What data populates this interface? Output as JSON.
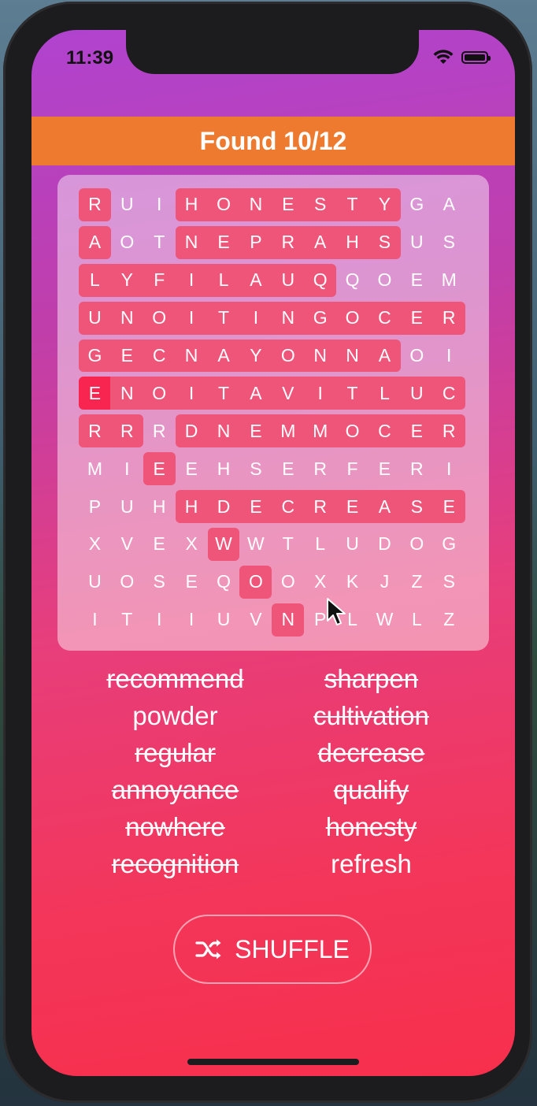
{
  "status_bar": {
    "time": "11:39"
  },
  "header": {
    "found_label": "Found 10/12"
  },
  "grid": {
    "rows": [
      [
        "R",
        "U",
        "I",
        "H",
        "O",
        "N",
        "E",
        "S",
        "T",
        "Y",
        "G",
        "A"
      ],
      [
        "A",
        "O",
        "T",
        "N",
        "E",
        "P",
        "R",
        "A",
        "H",
        "S",
        "U",
        "S"
      ],
      [
        "L",
        "Y",
        "F",
        "I",
        "L",
        "A",
        "U",
        "Q",
        "Q",
        "O",
        "E",
        "M"
      ],
      [
        "U",
        "N",
        "O",
        "I",
        "T",
        "I",
        "N",
        "G",
        "O",
        "C",
        "E",
        "R"
      ],
      [
        "G",
        "E",
        "C",
        "N",
        "A",
        "Y",
        "O",
        "N",
        "N",
        "A",
        "O",
        "I"
      ],
      [
        "E",
        "N",
        "O",
        "I",
        "T",
        "A",
        "V",
        "I",
        "T",
        "L",
        "U",
        "C"
      ],
      [
        "R",
        "R",
        "R",
        "D",
        "N",
        "E",
        "M",
        "M",
        "O",
        "C",
        "E",
        "R"
      ],
      [
        "M",
        "I",
        "E",
        "E",
        "H",
        "S",
        "E",
        "R",
        "F",
        "E",
        "R",
        "I"
      ],
      [
        "P",
        "U",
        "H",
        "H",
        "D",
        "E",
        "C",
        "R",
        "E",
        "A",
        "S",
        "E"
      ],
      [
        "X",
        "V",
        "E",
        "X",
        "W",
        "W",
        "T",
        "L",
        "U",
        "D",
        "O",
        "G"
      ],
      [
        "U",
        "O",
        "S",
        "E",
        "Q",
        "O",
        "O",
        "X",
        "K",
        "J",
        "Z",
        "S"
      ],
      [
        "I",
        "T",
        "I",
        "I",
        "U",
        "V",
        "N",
        "P",
        "L",
        "W",
        "L",
        "Z"
      ]
    ]
  },
  "words": [
    {
      "text": "recommend",
      "found": true
    },
    {
      "text": "sharpen",
      "found": true
    },
    {
      "text": "powder",
      "found": false
    },
    {
      "text": "cultivation",
      "found": true
    },
    {
      "text": "regular",
      "found": true
    },
    {
      "text": "decrease",
      "found": true
    },
    {
      "text": "annoyance",
      "found": true
    },
    {
      "text": "qualify",
      "found": true
    },
    {
      "text": "nowhere",
      "found": true
    },
    {
      "text": "honesty",
      "found": true
    },
    {
      "text": "recognition",
      "found": true
    },
    {
      "text": "refresh",
      "found": false
    }
  ],
  "shuffle_button": {
    "label": "SHUFFLE",
    "icon": "shuffle-icon"
  },
  "colors": {
    "accent_orange": "#ed7a2f",
    "highlight": "#ef5479",
    "highlight_active": "#f72550"
  }
}
